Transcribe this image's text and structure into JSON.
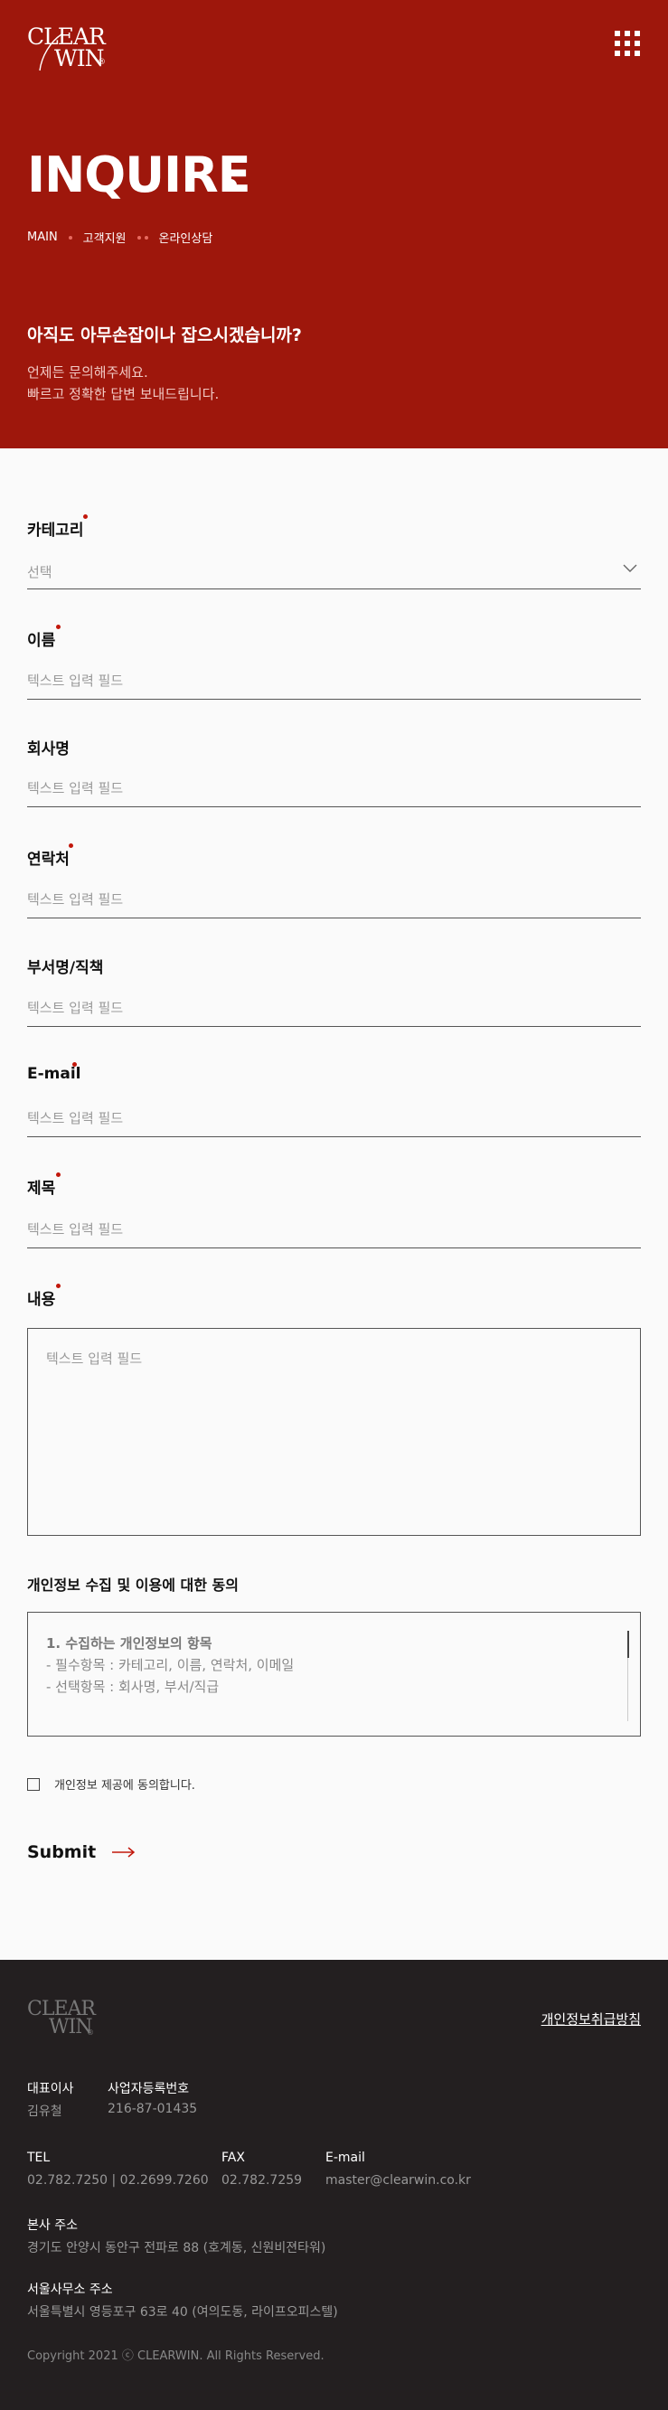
{
  "brand": {
    "logo_line1": "CLEAR",
    "logo_line2": "WIN",
    "logo_mark": "®"
  },
  "hero": {
    "title": "INQUIRE",
    "breadcrumb": [
      "MAIN",
      "고객지원",
      "온라인상담"
    ],
    "question": "아직도 아무손잡이나 잡으시겠습니까?",
    "sub_line1": "언제든 문의해주세요.",
    "sub_line2": "빠르고 정확한 답변 보내드립니다."
  },
  "form": {
    "category": {
      "label": "카테고리",
      "value": "선택",
      "required": true
    },
    "name": {
      "label": "이름",
      "placeholder": "텍스트 입력 필드",
      "required": true
    },
    "company": {
      "label": "회사명",
      "placeholder": "텍스트 입력 필드",
      "required": false
    },
    "phone": {
      "label": "연락처",
      "placeholder": "텍스트 입력 필드",
      "required": true
    },
    "department": {
      "label": "부서명/직책",
      "placeholder": "텍스트 입력 필드",
      "required": false
    },
    "email": {
      "label": "E-mail",
      "placeholder": "텍스트 입력 필드",
      "required": true
    },
    "subject": {
      "label": "제목",
      "placeholder": "텍스트 입력 필드",
      "required": true
    },
    "content": {
      "label": "내용",
      "placeholder": "텍스트 입력 필드",
      "required": true
    },
    "privacy": {
      "title": "개인정보 수집 및 이용에 대한 동의",
      "heading": "1. 수집하는 개인정보의 항목",
      "line1": "- 필수항목 : 카테고리, 이름, 연락처, 이메일",
      "line2": "- 선택항목 : 회사명, 부서/직급"
    },
    "agree_label": "개인정보 제공에 동의합니다.",
    "submit_label": "Submit"
  },
  "footer": {
    "logo_line1": "CLEAR",
    "logo_line2": "WIN",
    "logo_mark": "®",
    "policy_link": "개인정보취급방침",
    "ceo_label": "대표이사",
    "ceo_value": "김유철",
    "biz_label": "사업자등록번호",
    "biz_value": "216-87-01435",
    "tel_label": "TEL",
    "tel_value": "02.782.7250 | 02.2699.7260",
    "fax_label": "FAX",
    "fax_value": "02.782.7259",
    "email_label": "E-mail",
    "email_value": "master@clearwin.co.kr",
    "hq_label": "본사 주소",
    "hq_value": "경기도 안양시 동안구 전파로 88 (호계동, 신원비젼타워)",
    "seoul_label": "서울사무소 주소",
    "seoul_value": "서울특별시 영등포구 63로 40 (여의도동, 라이프오피스텔)",
    "copyright": "Copyright 2021 ⓒ CLEARWIN. All Rights Reserved."
  },
  "colors": {
    "brand_red": "#9e170c",
    "required_dot": "#c2170b",
    "footer_bg": "#231f20"
  }
}
